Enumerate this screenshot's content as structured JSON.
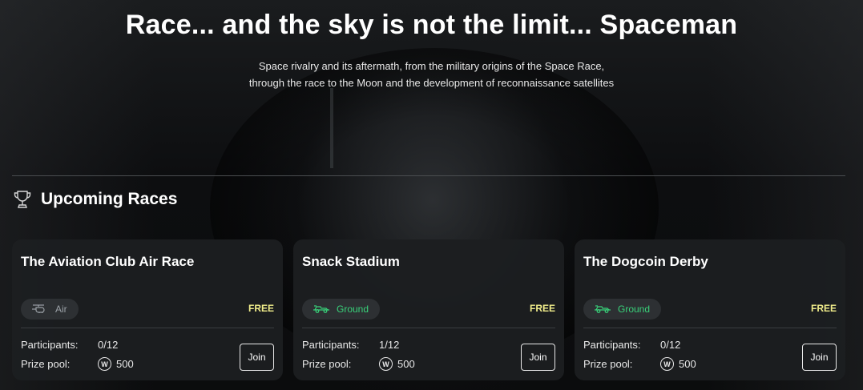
{
  "hero": {
    "title": "Race... and the sky is not the limit... Spaceman",
    "subtitle_line1": "Space rivalry and its aftermath, from the military origins of the Space Race,",
    "subtitle_line2": "through the race to the Moon and the development of reconnaissance satellites"
  },
  "section": {
    "icon": "trophy-icon",
    "title": "Upcoming Races"
  },
  "labels": {
    "participants": "Participants:",
    "prize_pool": "Prize pool:",
    "join": "Join"
  },
  "colors": {
    "free": "#f2ee8b",
    "ground": "#39d27a",
    "air": "#9aa0a6"
  },
  "races": [
    {
      "title": "The Aviation Club Air Race",
      "category": "Air",
      "category_icon": "helicopter-icon",
      "price": "FREE",
      "participants": "0/12",
      "prize_pool": "500"
    },
    {
      "title": "Snack Stadium",
      "category": "Ground",
      "category_icon": "race-car-icon",
      "price": "FREE",
      "participants": "1/12",
      "prize_pool": "500"
    },
    {
      "title": "The Dogcoin Derby",
      "category": "Ground",
      "category_icon": "race-car-icon",
      "price": "FREE",
      "participants": "0/12",
      "prize_pool": "500"
    }
  ]
}
